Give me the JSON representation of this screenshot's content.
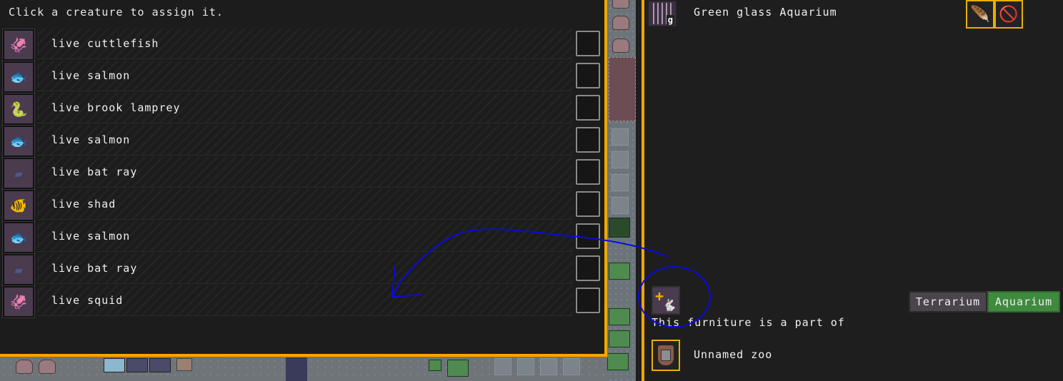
{
  "assign_panel": {
    "instruction": "Click a creature to assign it.",
    "creatures": [
      {
        "label": "live cuttlefish",
        "icon": "cuttlefish-icon",
        "glyph": "🦑"
      },
      {
        "label": "live salmon",
        "icon": "salmon-icon",
        "glyph": "🐟"
      },
      {
        "label": "live brook lamprey",
        "icon": "lamprey-icon",
        "glyph": "🐍"
      },
      {
        "label": "live salmon",
        "icon": "salmon-icon",
        "glyph": "🐟"
      },
      {
        "label": "live bat ray",
        "icon": "bat-ray-icon",
        "glyph": "▰"
      },
      {
        "label": "live shad",
        "icon": "shad-icon",
        "glyph": "🐠"
      },
      {
        "label": "live salmon",
        "icon": "salmon-icon",
        "glyph": "🐟"
      },
      {
        "label": "live bat ray",
        "icon": "bat-ray-icon",
        "glyph": "▰"
      },
      {
        "label": "live squid",
        "icon": "squid-icon",
        "glyph": "🦑"
      }
    ]
  },
  "furniture_panel": {
    "title": "Green glass Aquarium",
    "furniture_icon_letter": "g",
    "top_buttons": [
      {
        "name": "feather-icon",
        "glyph": "🪶"
      },
      {
        "name": "no-house-icon",
        "glyph": "🚫"
      }
    ],
    "part_of_text": "This furniture is a part of",
    "zone_name": "Unnamed zoo",
    "modes": {
      "terrarium": "Terrarium",
      "aquarium": "Aquarium",
      "active": "Aquarium"
    },
    "add_creature_plus": "+",
    "add_creature_glyph": "🐇"
  },
  "colors": {
    "frame": "#f0a800",
    "active_mode": "#3f8a3f",
    "annotation": "#0000e0"
  }
}
